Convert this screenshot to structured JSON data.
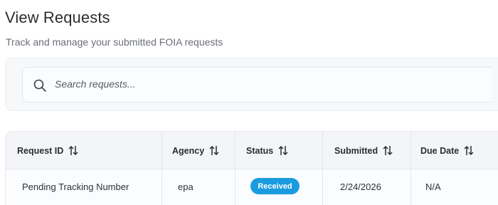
{
  "header": {
    "title": "View Requests",
    "subtitle": "Track and manage your submitted FOIA requests"
  },
  "search": {
    "placeholder": "Search requests...",
    "icon": "search-icon"
  },
  "table": {
    "columns": [
      {
        "label": "Request ID",
        "sort_icon": "sort-arrows-icon"
      },
      {
        "label": "Agency",
        "sort_icon": "sort-arrows-icon"
      },
      {
        "label": "Status",
        "sort_icon": "sort-arrows-icon"
      },
      {
        "label": "Submitted",
        "sort_icon": "sort-arrows-icon"
      },
      {
        "label": "Due Date",
        "sort_icon": "sort-arrows-icon"
      }
    ],
    "rows": [
      {
        "request_id": "Pending Tracking Number",
        "agency": "epa",
        "status": "Received",
        "submitted": "2/24/2026",
        "due_date": "N/A"
      }
    ]
  },
  "colors": {
    "status_received": "#1a9be0",
    "title_text": "#2c2d30",
    "subtitle_text": "#6a6e76"
  }
}
